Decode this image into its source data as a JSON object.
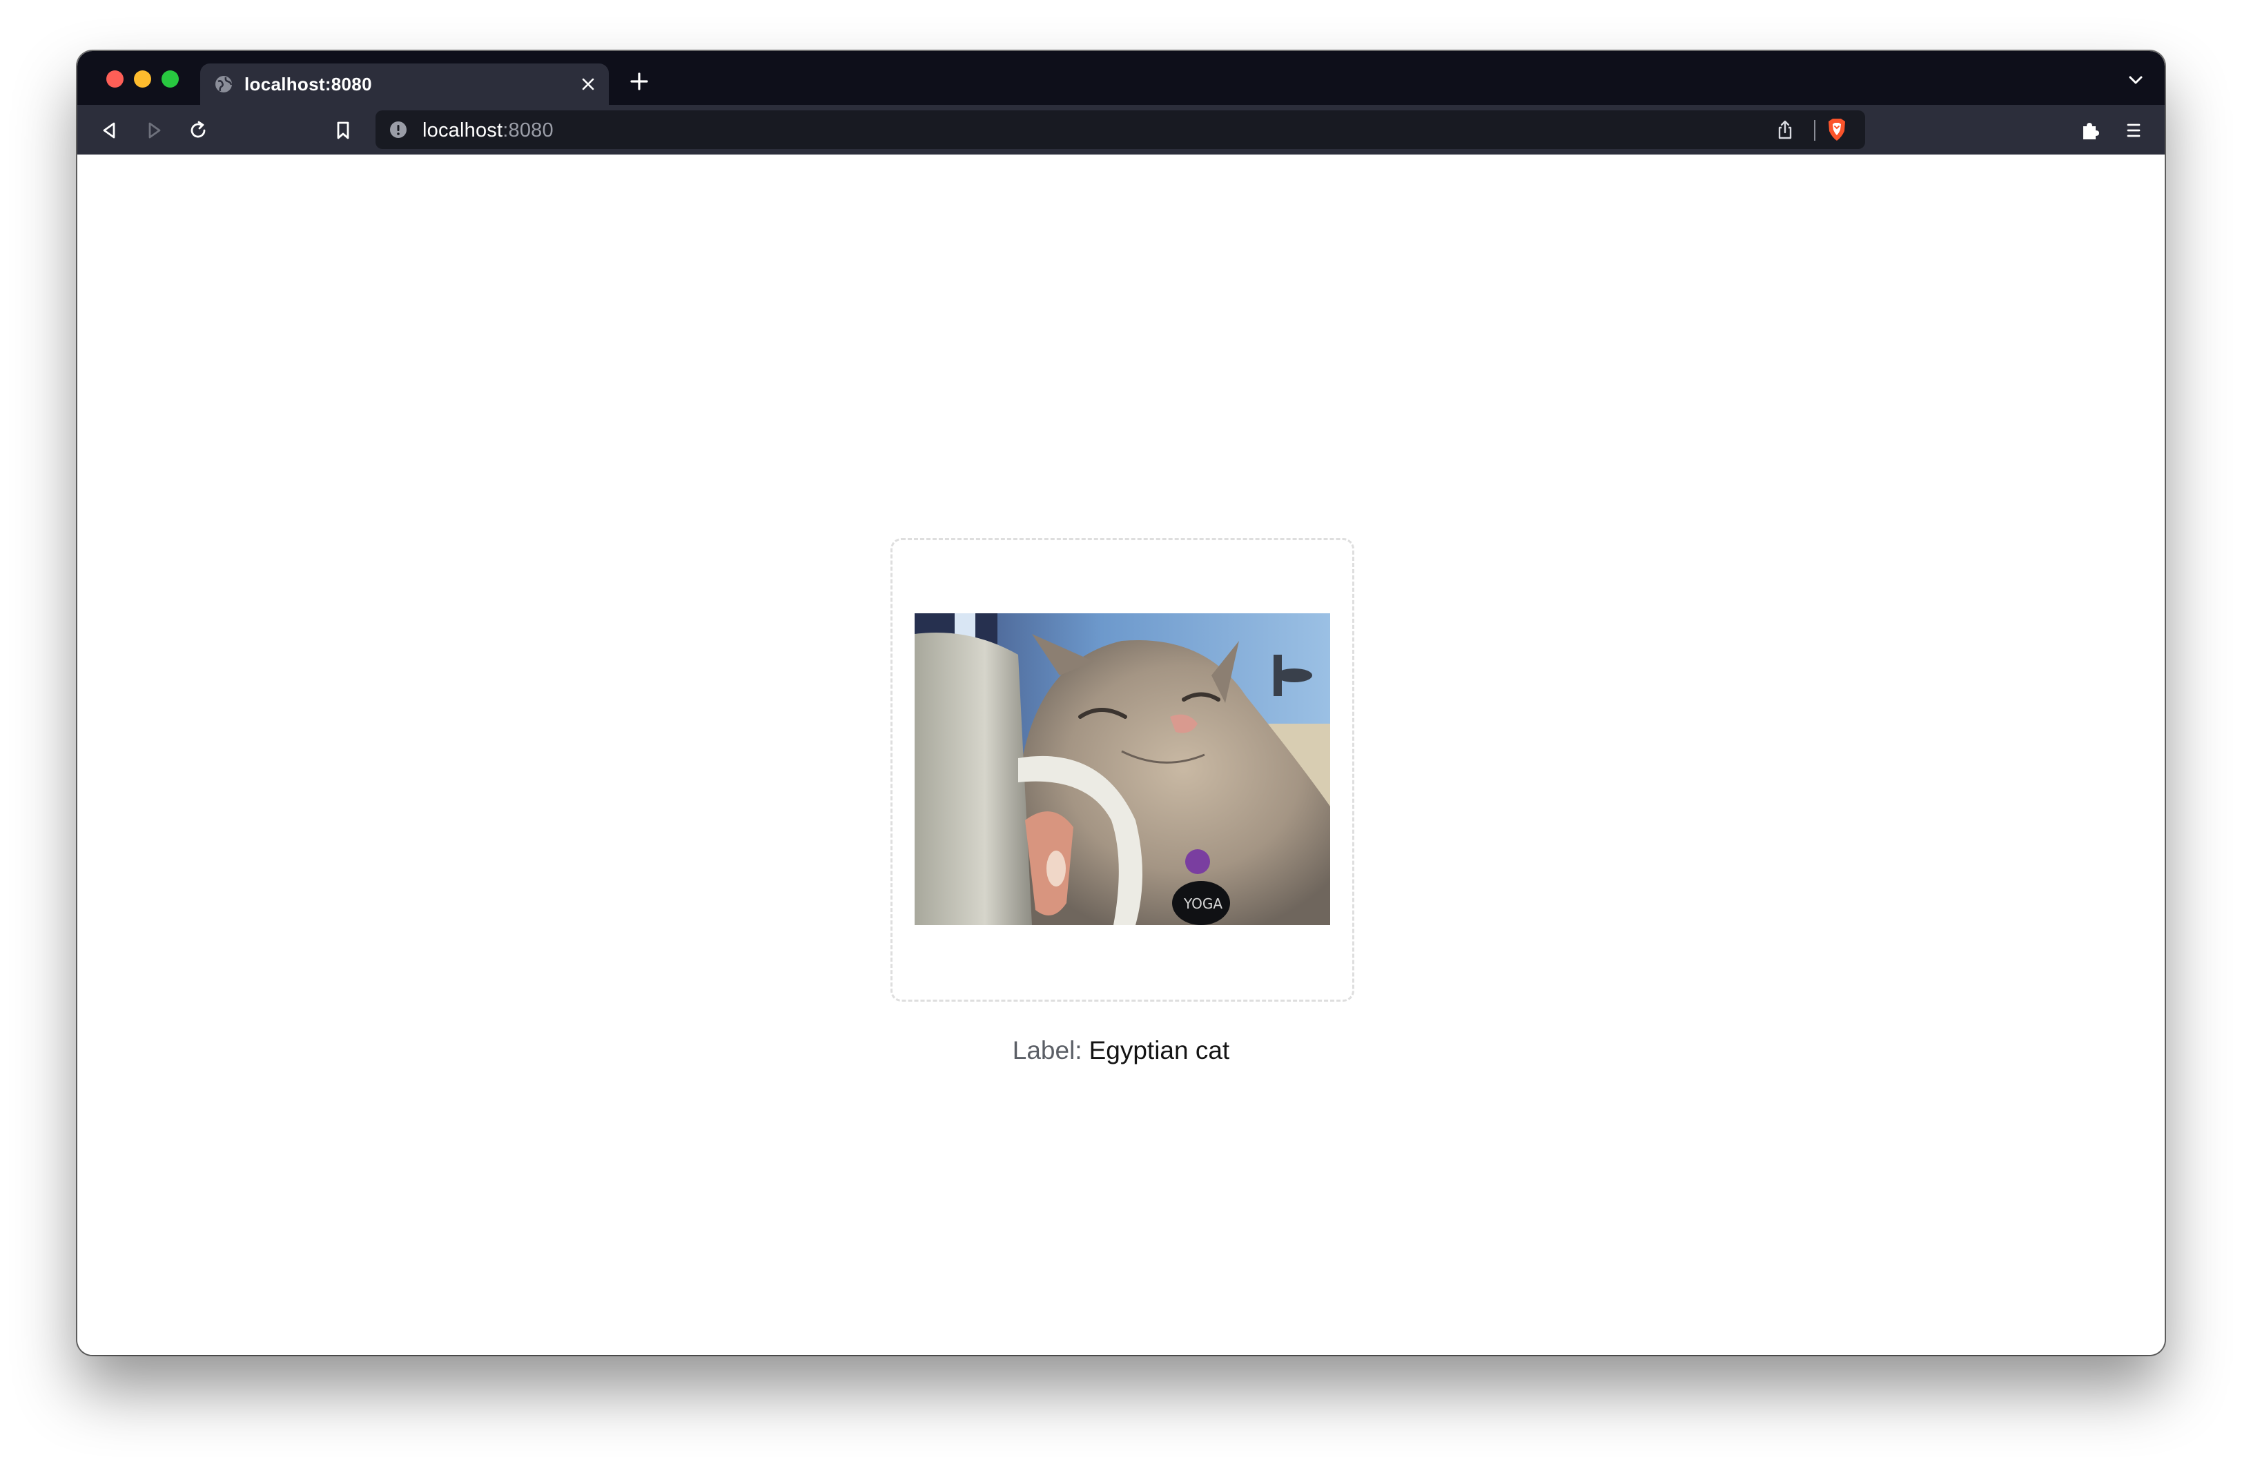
{
  "browser": {
    "tab": {
      "title": "localhost:8080",
      "favicon": "globe-icon"
    },
    "address_bar": {
      "host": "localhost",
      "port": ":8080",
      "security_icon": "info-icon"
    },
    "toolbar_icons": [
      "back-icon",
      "forward-icon",
      "reload-icon",
      "bookmark-icon",
      "share-icon",
      "brave-shields-icon",
      "extensions-icon",
      "menu-icon"
    ],
    "colors": {
      "titlebar": "#0e0f1a",
      "toolbar": "#2c2e3b",
      "urlbar": "#181a22",
      "brave_accent": "#fb542b"
    }
  },
  "page": {
    "image": {
      "subject": "cat-photo"
    },
    "label": {
      "key": "Label:",
      "value": "Egyptian cat"
    }
  }
}
